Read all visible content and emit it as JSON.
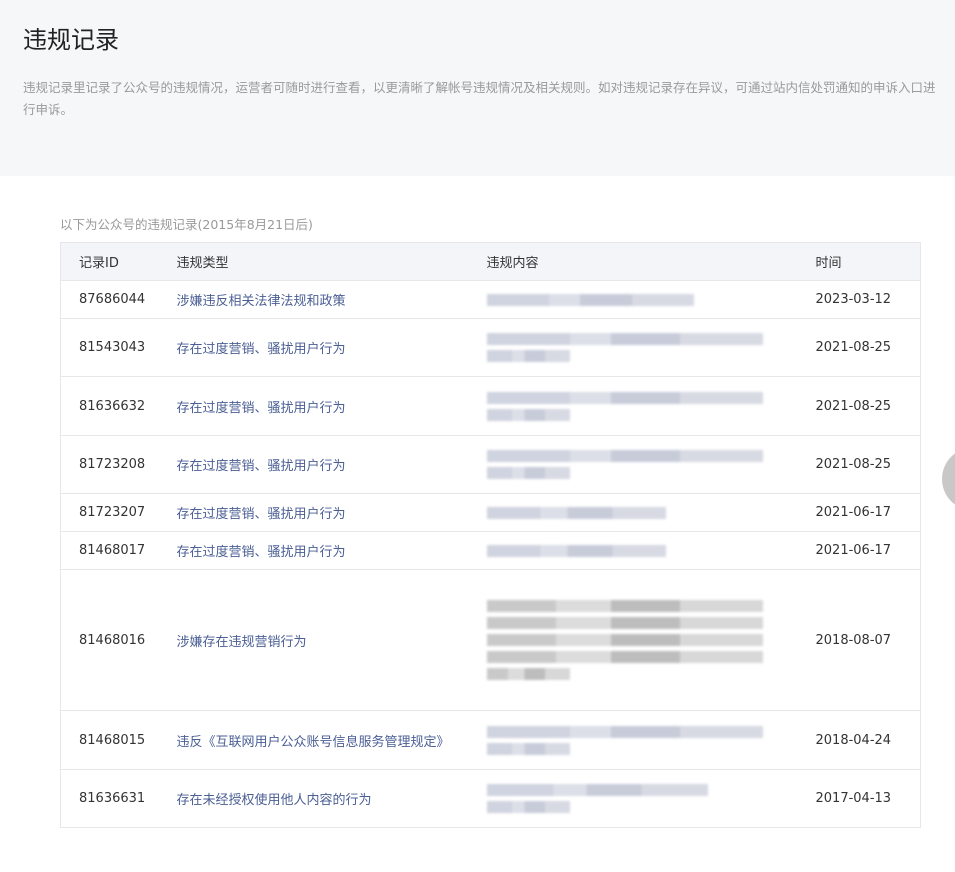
{
  "page": {
    "title": "违规记录",
    "description": "违规记录里记录了公众号的违规情况，运营者可随时进行查看，以更清晰了解帐号违规情况及相关规则。如对违规记录存在异议，可通过站内信处罚通知的申诉入口进行申诉。"
  },
  "records": {
    "caption": "以下为公众号的违规记录(2015年8月21日后)",
    "headers": [
      "记录ID",
      "违规类型",
      "违规内容",
      "时间"
    ],
    "rows": [
      {
        "id": "87686044",
        "type": "涉嫌违反相关法律法规和政策",
        "date": "2023-03-12"
      },
      {
        "id": "81543043",
        "type": "存在过度营销、骚扰用户行为",
        "date": "2021-08-25"
      },
      {
        "id": "81636632",
        "type": "存在过度营销、骚扰用户行为",
        "date": "2021-08-25"
      },
      {
        "id": "81723208",
        "type": "存在过度营销、骚扰用户行为",
        "date": "2021-08-25"
      },
      {
        "id": "81723207",
        "type": "存在过度营销、骚扰用户行为",
        "date": "2021-06-17"
      },
      {
        "id": "81468017",
        "type": "存在过度营销、骚扰用户行为",
        "date": "2021-06-17"
      },
      {
        "id": "81468016",
        "type": "涉嫌存在违规营销行为",
        "date": "2018-08-07"
      },
      {
        "id": "81468015",
        "type": "违反《互联网用户公众账号信息服务管理规定》",
        "date": "2018-04-24"
      },
      {
        "id": "81636631",
        "type": "存在未经授权使用他人内容的行为",
        "date": "2017-04-13"
      }
    ]
  }
}
